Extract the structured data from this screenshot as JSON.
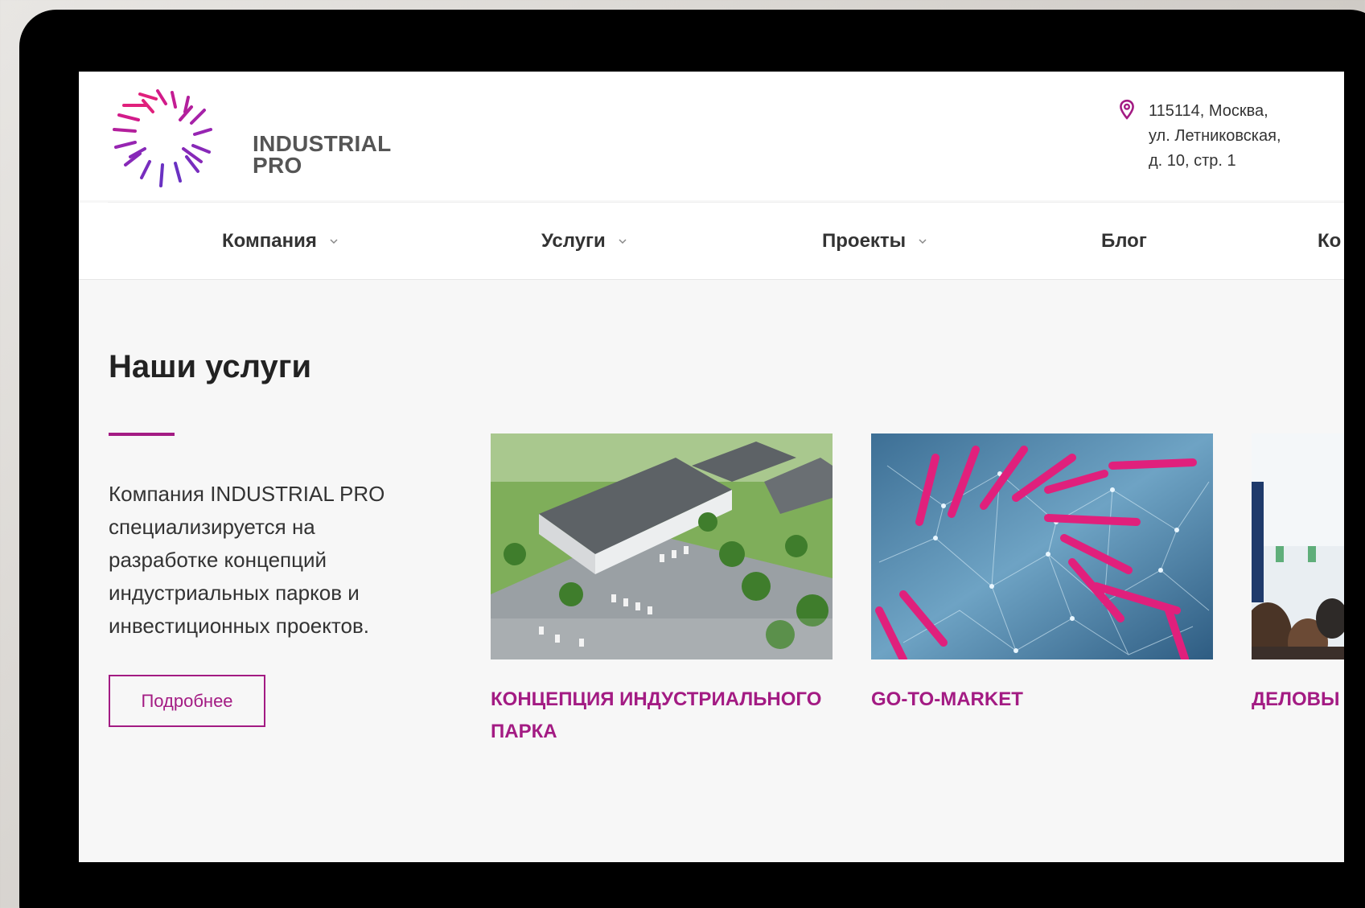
{
  "brand": {
    "name_line1": "INDUSTRIAL",
    "name_line2": "PRO",
    "accent": "#a31b83"
  },
  "header": {
    "address": "115114, Москва,\nул. Летниковская,\nд. 10, стр. 1",
    "address_icon": "map-pin-icon"
  },
  "nav": {
    "items": [
      {
        "label": "Компания",
        "has_dropdown": true
      },
      {
        "label": "Услуги",
        "has_dropdown": true
      },
      {
        "label": "Проекты",
        "has_dropdown": true
      },
      {
        "label": "Блог",
        "has_dropdown": false
      },
      {
        "label": "Ко",
        "has_dropdown": false
      }
    ]
  },
  "main": {
    "title": "Наши услуги",
    "description": "Компания INDUSTRIAL PRO специализируется на разработке концепций индустриальных парков и инвестиционных проектов.",
    "more_button": "Подробнее",
    "cards": [
      {
        "title": "КОНЦЕПЦИЯ ИНДУСТРИАЛЬНОГО ПАРКА",
        "image": "industrial-park-aerial"
      },
      {
        "title": "GO-TO-MARKET",
        "image": "network-abstract"
      },
      {
        "title": "ДЕЛОВЫ",
        "image": "conference-audience"
      }
    ]
  }
}
